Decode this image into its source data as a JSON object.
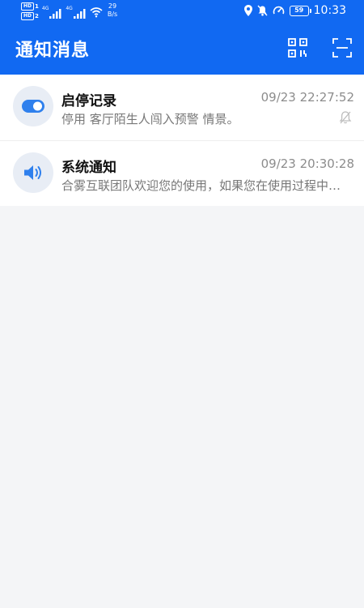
{
  "status_bar": {
    "hd1": "HD",
    "sim1": "1",
    "hd2": "HD",
    "sim2": "2",
    "net1": "4G",
    "net2": "4G",
    "speed_value": "29",
    "speed_unit": "B/s",
    "battery": "59",
    "time": "10:33"
  },
  "header": {
    "title": "通知消息",
    "qr_icon": "qr-code-icon",
    "scan_icon": "scan-icon"
  },
  "notifications": [
    {
      "icon": "toggle-icon",
      "title": "启停记录",
      "time": "09/23 22:27:52",
      "preview": "停用 客厅陌生人闯入预警 情景。",
      "muted": true
    },
    {
      "icon": "speaker-icon",
      "title": "系统通知",
      "time": "09/23 20:30:28",
      "preview": "合雾互联团队欢迎您的使用，如果您在使用过程中遇到任何问题",
      "muted": false
    }
  ],
  "colors": {
    "brand": "#1169f2",
    "icon_blue": "#2f80ed",
    "avatar_bg": "#e8edf5"
  }
}
